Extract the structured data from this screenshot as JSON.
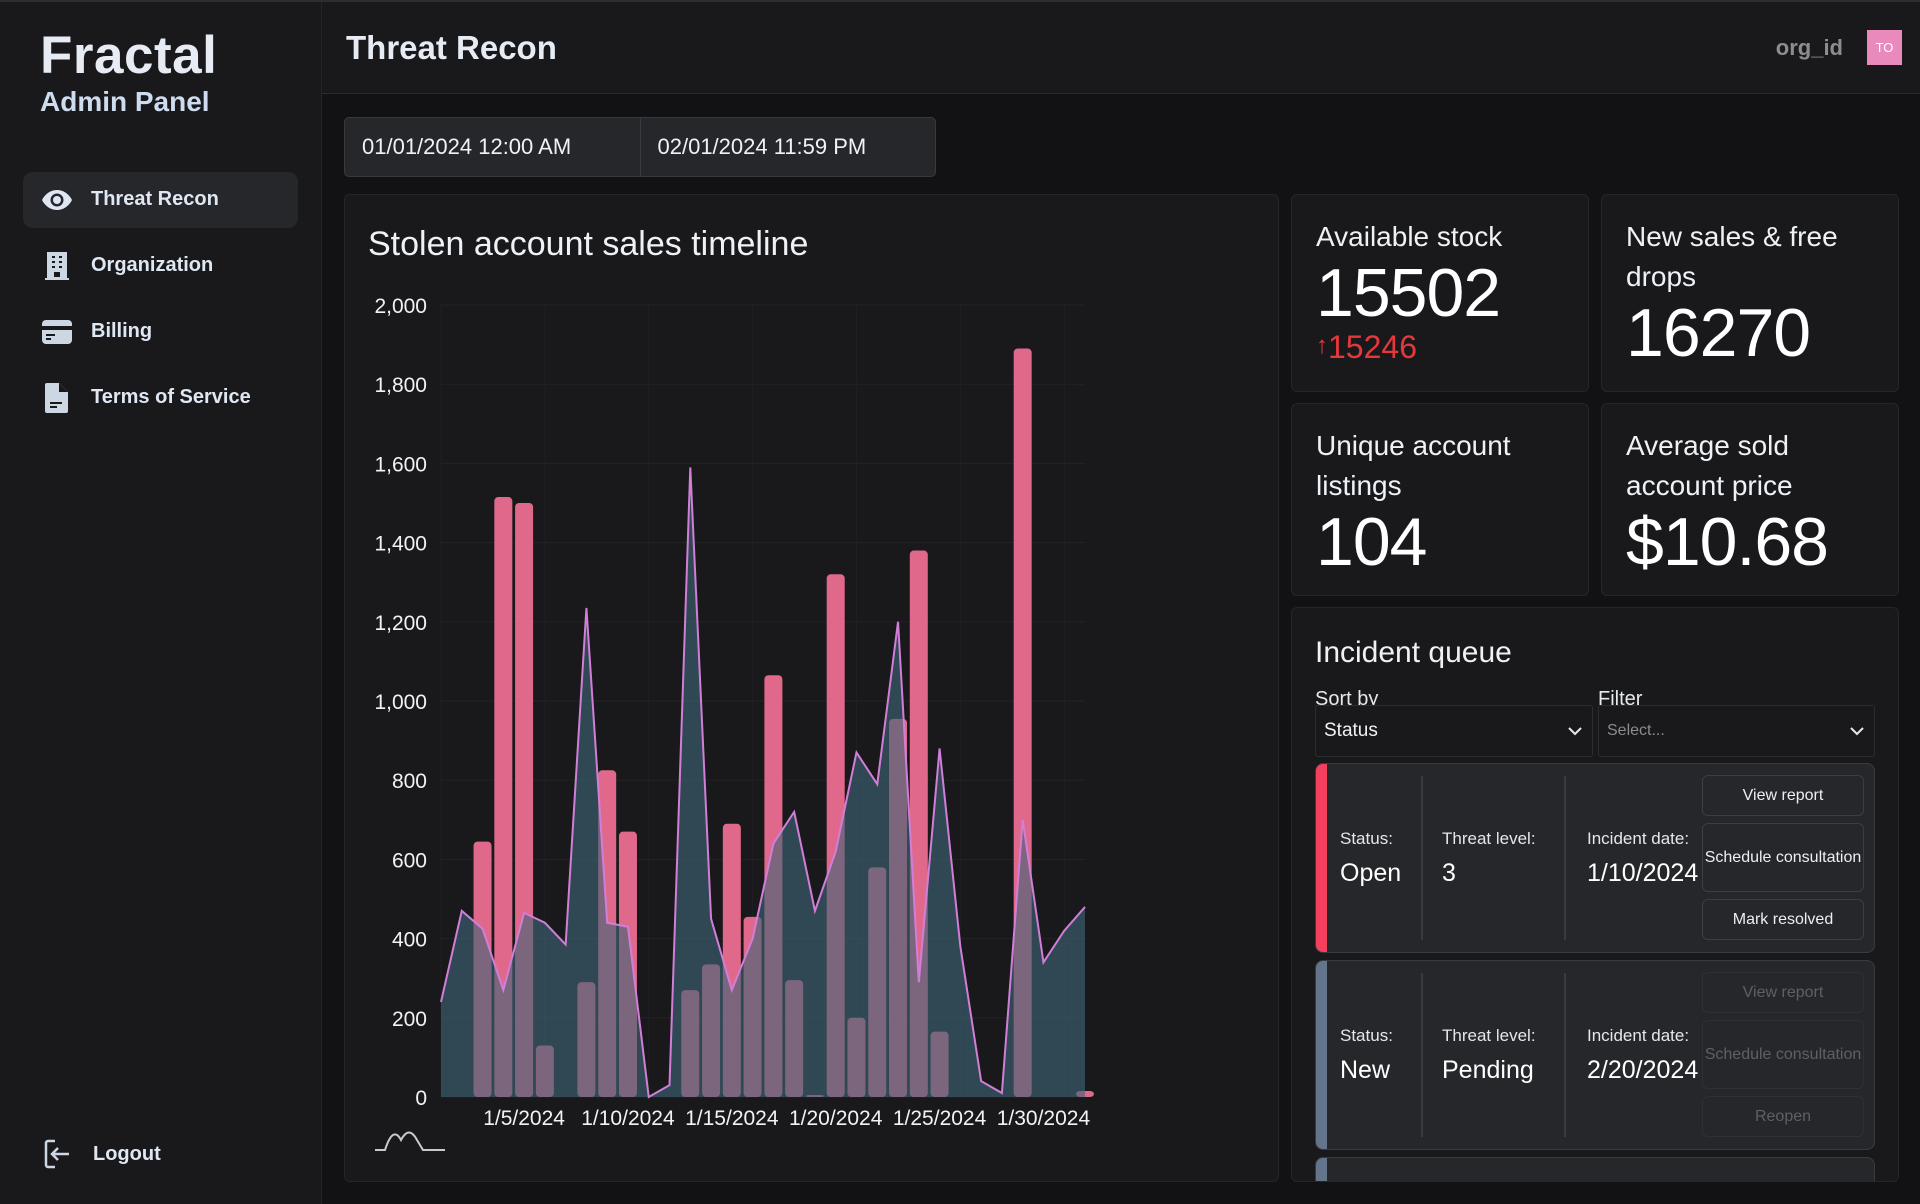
{
  "sidebar": {
    "brand_title": "Fractal",
    "brand_subtitle": "Admin Panel",
    "items": [
      {
        "label": "Threat Recon",
        "icon": "eye-icon",
        "active": true
      },
      {
        "label": "Organization",
        "icon": "building-icon",
        "active": false
      },
      {
        "label": "Billing",
        "icon": "credit-card-icon",
        "active": false
      },
      {
        "label": "Terms of Service",
        "icon": "document-icon",
        "active": false
      }
    ],
    "logout_label": "Logout"
  },
  "header": {
    "title": "Threat Recon",
    "org_id": "org_id",
    "avatar_initials": "TO",
    "avatar_color": "#e98abc"
  },
  "date_range": {
    "start": "01/01/2024 12:00 AM",
    "end": "02/01/2024 11:59 PM"
  },
  "stats": {
    "available_stock": {
      "label": "Available stock",
      "value": "15502",
      "delta": "15246",
      "delta_direction": "up",
      "delta_color": "#e5383b"
    },
    "new_sales": {
      "label": "New sales & free drops",
      "value": "16270"
    },
    "unique_listings": {
      "label": "Unique account listings",
      "value": "104"
    },
    "avg_price": {
      "label": "Average sold account price",
      "value": "$10.68"
    }
  },
  "incident_queue": {
    "title": "Incident queue",
    "sort_label": "Sort by",
    "sort_value": "Status",
    "filter_label": "Filter",
    "filter_placeholder": "Select...",
    "incidents": [
      {
        "status_label": "Status:",
        "status": "Open",
        "threat_label": "Threat level:",
        "threat": "3",
        "date_label": "Incident date:",
        "date": "1/10/2024",
        "stripe_color": "#f43f5e",
        "actions": [
          {
            "label": "View report",
            "disabled": false
          },
          {
            "label": "Schedule consultation",
            "disabled": false
          },
          {
            "label": "Mark resolved",
            "disabled": false
          }
        ]
      },
      {
        "status_label": "Status:",
        "status": "New",
        "threat_label": "Threat level:",
        "threat": "Pending",
        "date_label": "Incident date:",
        "date": "2/20/2024",
        "stripe_color": "#64748b",
        "actions": [
          {
            "label": "View report",
            "disabled": true
          },
          {
            "label": "Schedule consultation",
            "disabled": true
          },
          {
            "label": "Reopen",
            "disabled": true
          }
        ]
      }
    ]
  },
  "chart_data": {
    "type": "bar",
    "title": "Stolen account sales timeline",
    "xlabel": "",
    "ylabel": "",
    "ylim": [
      0,
      2000
    ],
    "yticks": [
      0,
      200,
      400,
      600,
      800,
      1000,
      1200,
      1400,
      1600,
      1800,
      2000
    ],
    "ytick_labels": [
      "0",
      "200",
      "400",
      "600",
      "800",
      "1,000",
      "1,200",
      "1,400",
      "1,600",
      "1,800",
      "2,000"
    ],
    "xtick_labels": [
      "1/5/2024",
      "1/10/2024",
      "1/15/2024",
      "1/20/2024",
      "1/25/2024",
      "1/30/2024"
    ],
    "xtick_indices": [
      4,
      9,
      14,
      19,
      24,
      29
    ],
    "grid": true,
    "x": [
      "1/1",
      "1/2",
      "1/3",
      "1/4",
      "1/5",
      "1/6",
      "1/7",
      "1/8",
      "1/9",
      "1/10",
      "1/11",
      "1/12",
      "1/13",
      "1/14",
      "1/15",
      "1/16",
      "1/17",
      "1/18",
      "1/19",
      "1/20",
      "1/21",
      "1/22",
      "1/23",
      "1/24",
      "1/25",
      "1/26",
      "1/27",
      "1/28",
      "1/29",
      "1/30",
      "1/31",
      "2/1"
    ],
    "series": [
      {
        "name": "bars",
        "type": "bar",
        "color": "#e0688a",
        "values": [
          0,
          0,
          645,
          1515,
          1500,
          130,
          0,
          290,
          825,
          670,
          0,
          0,
          270,
          335,
          690,
          455,
          1065,
          295,
          5,
          1320,
          200,
          580,
          955,
          1380,
          165,
          0,
          0,
          0,
          1890,
          0,
          0,
          15
        ]
      },
      {
        "name": "area",
        "type": "area",
        "color": "#3f6678",
        "line_color": "#d17ed8",
        "values": [
          240,
          470,
          425,
          270,
          465,
          440,
          385,
          1235,
          440,
          430,
          0,
          30,
          1590,
          450,
          270,
          400,
          640,
          720,
          470,
          620,
          870,
          790,
          1200,
          290,
          880,
          380,
          40,
          10,
          700,
          340,
          420,
          480
        ]
      }
    ]
  }
}
